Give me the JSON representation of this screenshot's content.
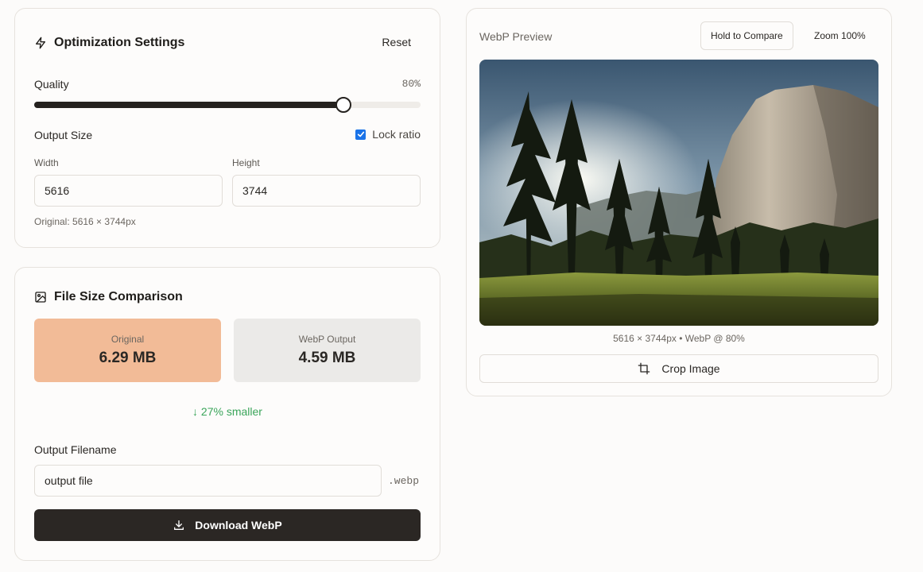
{
  "settings": {
    "title": "Optimization Settings",
    "reset_label": "Reset",
    "quality_label": "Quality",
    "quality_value_text": "80%",
    "quality_value": 80,
    "output_size_label": "Output Size",
    "lock_ratio_label": "Lock ratio",
    "lock_ratio_checked": true,
    "width_label": "Width",
    "width_value": "5616",
    "height_label": "Height",
    "height_value": "3744",
    "original_note": "Original: 5616 × 3744px"
  },
  "comparison": {
    "title": "File Size Comparison",
    "original_caption": "Original",
    "original_size": "6.29 MB",
    "output_caption": "WebP Output",
    "output_size": "4.59 MB",
    "reduction_text": "↓ 27% smaller",
    "filename_label": "Output Filename",
    "filename_value": "output file",
    "extension": ".webp",
    "download_label": "Download WebP"
  },
  "preview": {
    "title": "WebP Preview",
    "compare_label": "Hold to Compare",
    "zoom_label": "Zoom 100%",
    "info_text": "5616 × 3744px • WebP @ 80%",
    "crop_label": "Crop Image"
  },
  "colors": {
    "original_box": "#f2bb97",
    "output_box": "#ebeae8",
    "reduction_green": "#3aa55a",
    "primary_dark": "#2b2724",
    "checkbox_blue": "#1a73e8"
  },
  "icons": {
    "settings": "zap-icon",
    "comparison": "image-icon",
    "download": "download-icon",
    "crop": "crop-icon"
  }
}
